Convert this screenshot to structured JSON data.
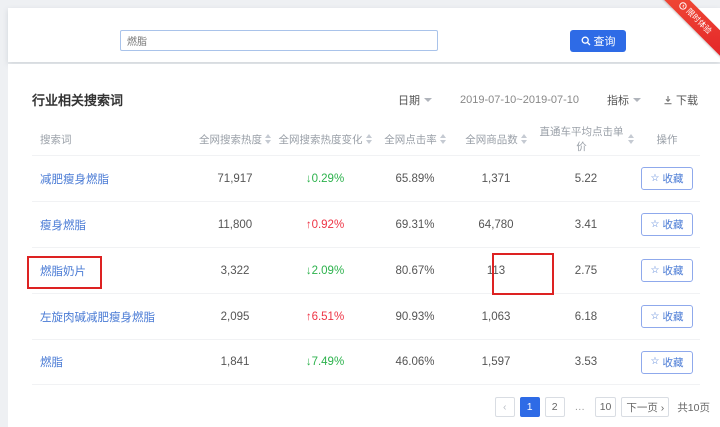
{
  "ribbon": {
    "label": "限时体验"
  },
  "search": {
    "value": "燃脂",
    "placeholder": "",
    "button_label": "查询"
  },
  "section": {
    "title": "行业相关搜索词",
    "date_label": "日期",
    "date_range": "2019-07-10~2019-07-10",
    "metric_label": "指标",
    "download_label": "下载"
  },
  "table": {
    "columns": [
      {
        "label": "搜索词",
        "sortable": false
      },
      {
        "label": "全网搜索热度",
        "sortable": true
      },
      {
        "label": "全网搜索热度变化",
        "sortable": true
      },
      {
        "label": "全网点击率",
        "sortable": true
      },
      {
        "label": "全网商品数",
        "sortable": true
      },
      {
        "label": "直通车平均点击单价",
        "sortable": true
      },
      {
        "label": "操作",
        "sortable": false
      }
    ],
    "rows": [
      {
        "keyword": "减肥瘦身燃脂",
        "heat": "71,917",
        "change": "0.29%",
        "change_dir": "down",
        "ctr": "65.89%",
        "items": "1,371",
        "cpc": "5.22",
        "action": "收藏"
      },
      {
        "keyword": "瘦身燃脂",
        "heat": "11,800",
        "change": "0.92%",
        "change_dir": "up",
        "ctr": "69.31%",
        "items": "64,780",
        "cpc": "3.41",
        "action": "收藏"
      },
      {
        "keyword": "燃脂奶片",
        "heat": "3,322",
        "change": "2.09%",
        "change_dir": "down",
        "ctr": "80.67%",
        "items": "113",
        "cpc": "2.75",
        "action": "收藏",
        "keyword_annotated": true,
        "items_annotated": true
      },
      {
        "keyword": "左旋肉碱减肥瘦身燃脂",
        "heat": "2,095",
        "change": "6.51%",
        "change_dir": "up",
        "ctr": "90.93%",
        "items": "1,063",
        "cpc": "6.18",
        "action": "收藏"
      },
      {
        "keyword": "燃脂",
        "heat": "1,841",
        "change": "7.49%",
        "change_dir": "down",
        "ctr": "46.06%",
        "items": "1,597",
        "cpc": "3.53",
        "action": "收藏"
      }
    ]
  },
  "pagination": {
    "prev": "‹",
    "pages": [
      "1",
      "2",
      "…",
      "10"
    ],
    "active_page": "1",
    "next_label": "下一页",
    "next_arrow": "›",
    "total_label": "共10页"
  },
  "glyphs": {
    "up_arrow": "↑",
    "down_arrow": "↓",
    "star": "☆"
  },
  "icons": {
    "search": "magnifier-icon",
    "download": "download-arrow-icon",
    "caret": "chevron-down-icon",
    "sort": "sort-arrows-icon",
    "clock": "clock-icon",
    "favorite": "star-outline-icon"
  },
  "colors": {
    "accent_blue": "#2e6be6",
    "link_blue": "#4a7bd5",
    "up_red": "#ee3445",
    "down_green": "#2cb24c",
    "annotation_red": "#dd2222",
    "ribbon_red": "#e22127"
  }
}
